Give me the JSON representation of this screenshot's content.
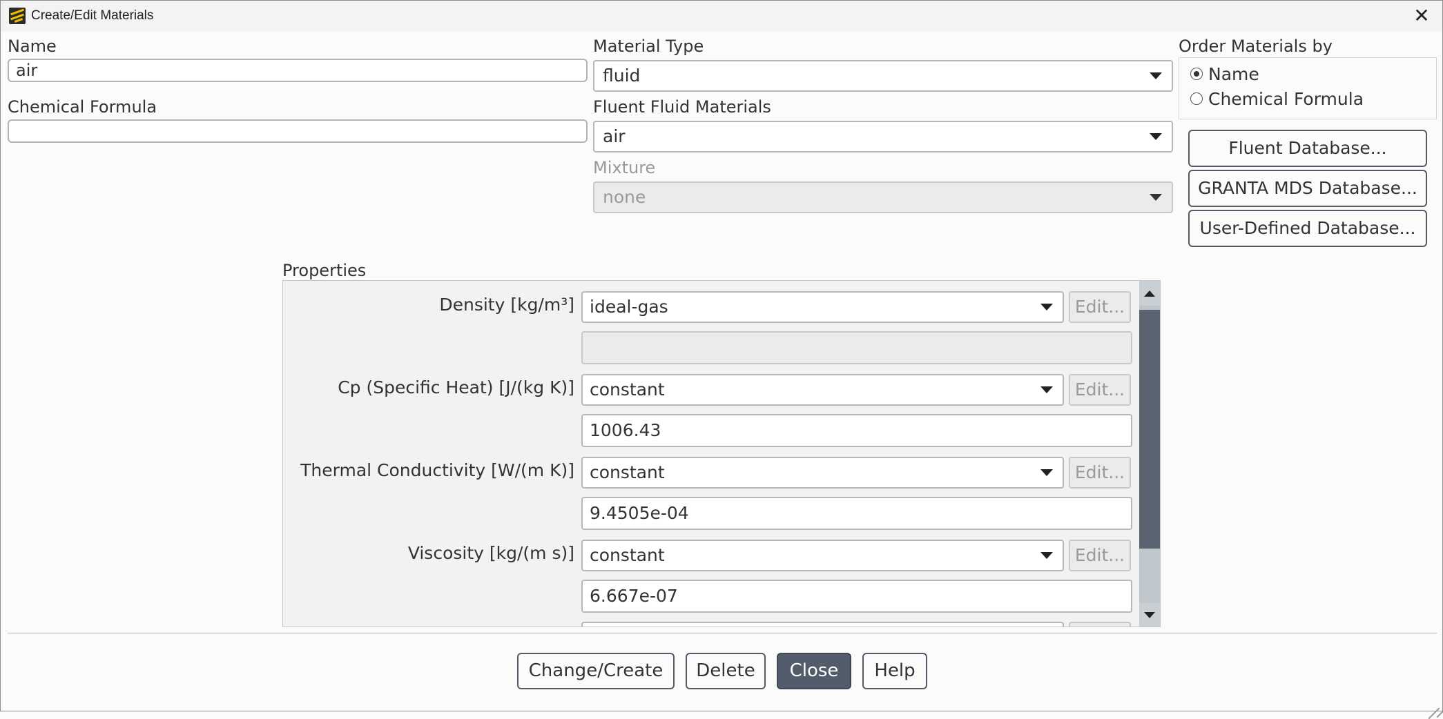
{
  "window": {
    "title": "Create/Edit Materials",
    "close_glyph": "✕"
  },
  "name": {
    "label": "Name",
    "value": "air"
  },
  "chemical_formula": {
    "label": "Chemical Formula",
    "value": ""
  },
  "material_type": {
    "label": "Material Type",
    "value": "fluid"
  },
  "fluent_fluid_materials": {
    "label": "Fluent Fluid Materials",
    "value": "air"
  },
  "mixture": {
    "label": "Mixture",
    "value": "none",
    "disabled": true
  },
  "order_by": {
    "label": "Order Materials by",
    "options": [
      "Name",
      "Chemical Formula"
    ],
    "selected": "Name"
  },
  "database_buttons": [
    "Fluent Database...",
    "GRANTA MDS Database...",
    "User-Defined Database..."
  ],
  "properties": {
    "label": "Properties",
    "items": [
      {
        "label": "Density [kg/m³]",
        "method": "ideal-gas",
        "edit_label": "Edit...",
        "value": ""
      },
      {
        "label": "Cp (Specific Heat) [J/(kg K)]",
        "method": "constant",
        "edit_label": "Edit...",
        "value": "1006.43"
      },
      {
        "label": "Thermal Conductivity [W/(m K)]",
        "method": "constant",
        "edit_label": "Edit...",
        "value": "9.4505e-04"
      },
      {
        "label": "Viscosity [kg/(m s)]",
        "method": "constant",
        "edit_label": "Edit...",
        "value": "6.667e-07"
      }
    ]
  },
  "footer": {
    "change_create": "Change/Create",
    "delete": "Delete",
    "close": "Close",
    "help": "Help"
  }
}
